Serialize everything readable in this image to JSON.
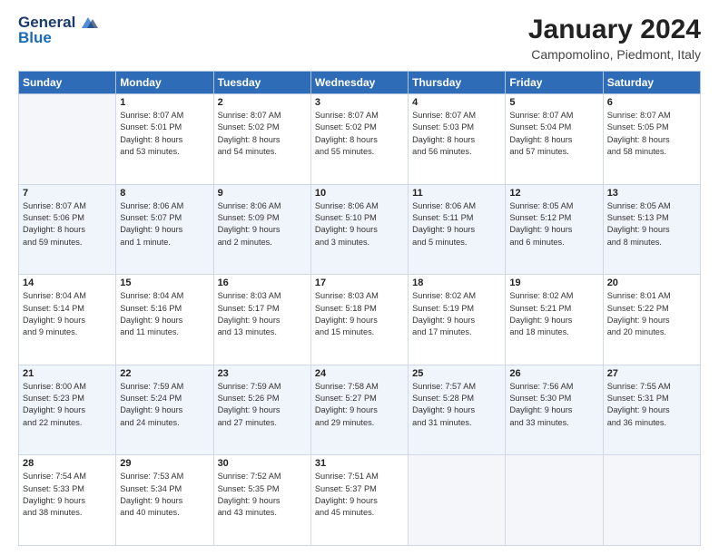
{
  "header": {
    "logo_general": "General",
    "logo_blue": "Blue",
    "month_title": "January 2024",
    "location": "Campomolino, Piedmont, Italy"
  },
  "days_of_week": [
    "Sunday",
    "Monday",
    "Tuesday",
    "Wednesday",
    "Thursday",
    "Friday",
    "Saturday"
  ],
  "weeks": [
    [
      {
        "day": "",
        "info": ""
      },
      {
        "day": "1",
        "info": "Sunrise: 8:07 AM\nSunset: 5:01 PM\nDaylight: 8 hours\nand 53 minutes."
      },
      {
        "day": "2",
        "info": "Sunrise: 8:07 AM\nSunset: 5:02 PM\nDaylight: 8 hours\nand 54 minutes."
      },
      {
        "day": "3",
        "info": "Sunrise: 8:07 AM\nSunset: 5:02 PM\nDaylight: 8 hours\nand 55 minutes."
      },
      {
        "day": "4",
        "info": "Sunrise: 8:07 AM\nSunset: 5:03 PM\nDaylight: 8 hours\nand 56 minutes."
      },
      {
        "day": "5",
        "info": "Sunrise: 8:07 AM\nSunset: 5:04 PM\nDaylight: 8 hours\nand 57 minutes."
      },
      {
        "day": "6",
        "info": "Sunrise: 8:07 AM\nSunset: 5:05 PM\nDaylight: 8 hours\nand 58 minutes."
      }
    ],
    [
      {
        "day": "7",
        "info": "Sunrise: 8:07 AM\nSunset: 5:06 PM\nDaylight: 8 hours\nand 59 minutes."
      },
      {
        "day": "8",
        "info": "Sunrise: 8:06 AM\nSunset: 5:07 PM\nDaylight: 9 hours\nand 1 minute."
      },
      {
        "day": "9",
        "info": "Sunrise: 8:06 AM\nSunset: 5:09 PM\nDaylight: 9 hours\nand 2 minutes."
      },
      {
        "day": "10",
        "info": "Sunrise: 8:06 AM\nSunset: 5:10 PM\nDaylight: 9 hours\nand 3 minutes."
      },
      {
        "day": "11",
        "info": "Sunrise: 8:06 AM\nSunset: 5:11 PM\nDaylight: 9 hours\nand 5 minutes."
      },
      {
        "day": "12",
        "info": "Sunrise: 8:05 AM\nSunset: 5:12 PM\nDaylight: 9 hours\nand 6 minutes."
      },
      {
        "day": "13",
        "info": "Sunrise: 8:05 AM\nSunset: 5:13 PM\nDaylight: 9 hours\nand 8 minutes."
      }
    ],
    [
      {
        "day": "14",
        "info": "Sunrise: 8:04 AM\nSunset: 5:14 PM\nDaylight: 9 hours\nand 9 minutes."
      },
      {
        "day": "15",
        "info": "Sunrise: 8:04 AM\nSunset: 5:16 PM\nDaylight: 9 hours\nand 11 minutes."
      },
      {
        "day": "16",
        "info": "Sunrise: 8:03 AM\nSunset: 5:17 PM\nDaylight: 9 hours\nand 13 minutes."
      },
      {
        "day": "17",
        "info": "Sunrise: 8:03 AM\nSunset: 5:18 PM\nDaylight: 9 hours\nand 15 minutes."
      },
      {
        "day": "18",
        "info": "Sunrise: 8:02 AM\nSunset: 5:19 PM\nDaylight: 9 hours\nand 17 minutes."
      },
      {
        "day": "19",
        "info": "Sunrise: 8:02 AM\nSunset: 5:21 PM\nDaylight: 9 hours\nand 18 minutes."
      },
      {
        "day": "20",
        "info": "Sunrise: 8:01 AM\nSunset: 5:22 PM\nDaylight: 9 hours\nand 20 minutes."
      }
    ],
    [
      {
        "day": "21",
        "info": "Sunrise: 8:00 AM\nSunset: 5:23 PM\nDaylight: 9 hours\nand 22 minutes."
      },
      {
        "day": "22",
        "info": "Sunrise: 7:59 AM\nSunset: 5:24 PM\nDaylight: 9 hours\nand 24 minutes."
      },
      {
        "day": "23",
        "info": "Sunrise: 7:59 AM\nSunset: 5:26 PM\nDaylight: 9 hours\nand 27 minutes."
      },
      {
        "day": "24",
        "info": "Sunrise: 7:58 AM\nSunset: 5:27 PM\nDaylight: 9 hours\nand 29 minutes."
      },
      {
        "day": "25",
        "info": "Sunrise: 7:57 AM\nSunset: 5:28 PM\nDaylight: 9 hours\nand 31 minutes."
      },
      {
        "day": "26",
        "info": "Sunrise: 7:56 AM\nSunset: 5:30 PM\nDaylight: 9 hours\nand 33 minutes."
      },
      {
        "day": "27",
        "info": "Sunrise: 7:55 AM\nSunset: 5:31 PM\nDaylight: 9 hours\nand 36 minutes."
      }
    ],
    [
      {
        "day": "28",
        "info": "Sunrise: 7:54 AM\nSunset: 5:33 PM\nDaylight: 9 hours\nand 38 minutes."
      },
      {
        "day": "29",
        "info": "Sunrise: 7:53 AM\nSunset: 5:34 PM\nDaylight: 9 hours\nand 40 minutes."
      },
      {
        "day": "30",
        "info": "Sunrise: 7:52 AM\nSunset: 5:35 PM\nDaylight: 9 hours\nand 43 minutes."
      },
      {
        "day": "31",
        "info": "Sunrise: 7:51 AM\nSunset: 5:37 PM\nDaylight: 9 hours\nand 45 minutes."
      },
      {
        "day": "",
        "info": ""
      },
      {
        "day": "",
        "info": ""
      },
      {
        "day": "",
        "info": ""
      }
    ]
  ]
}
